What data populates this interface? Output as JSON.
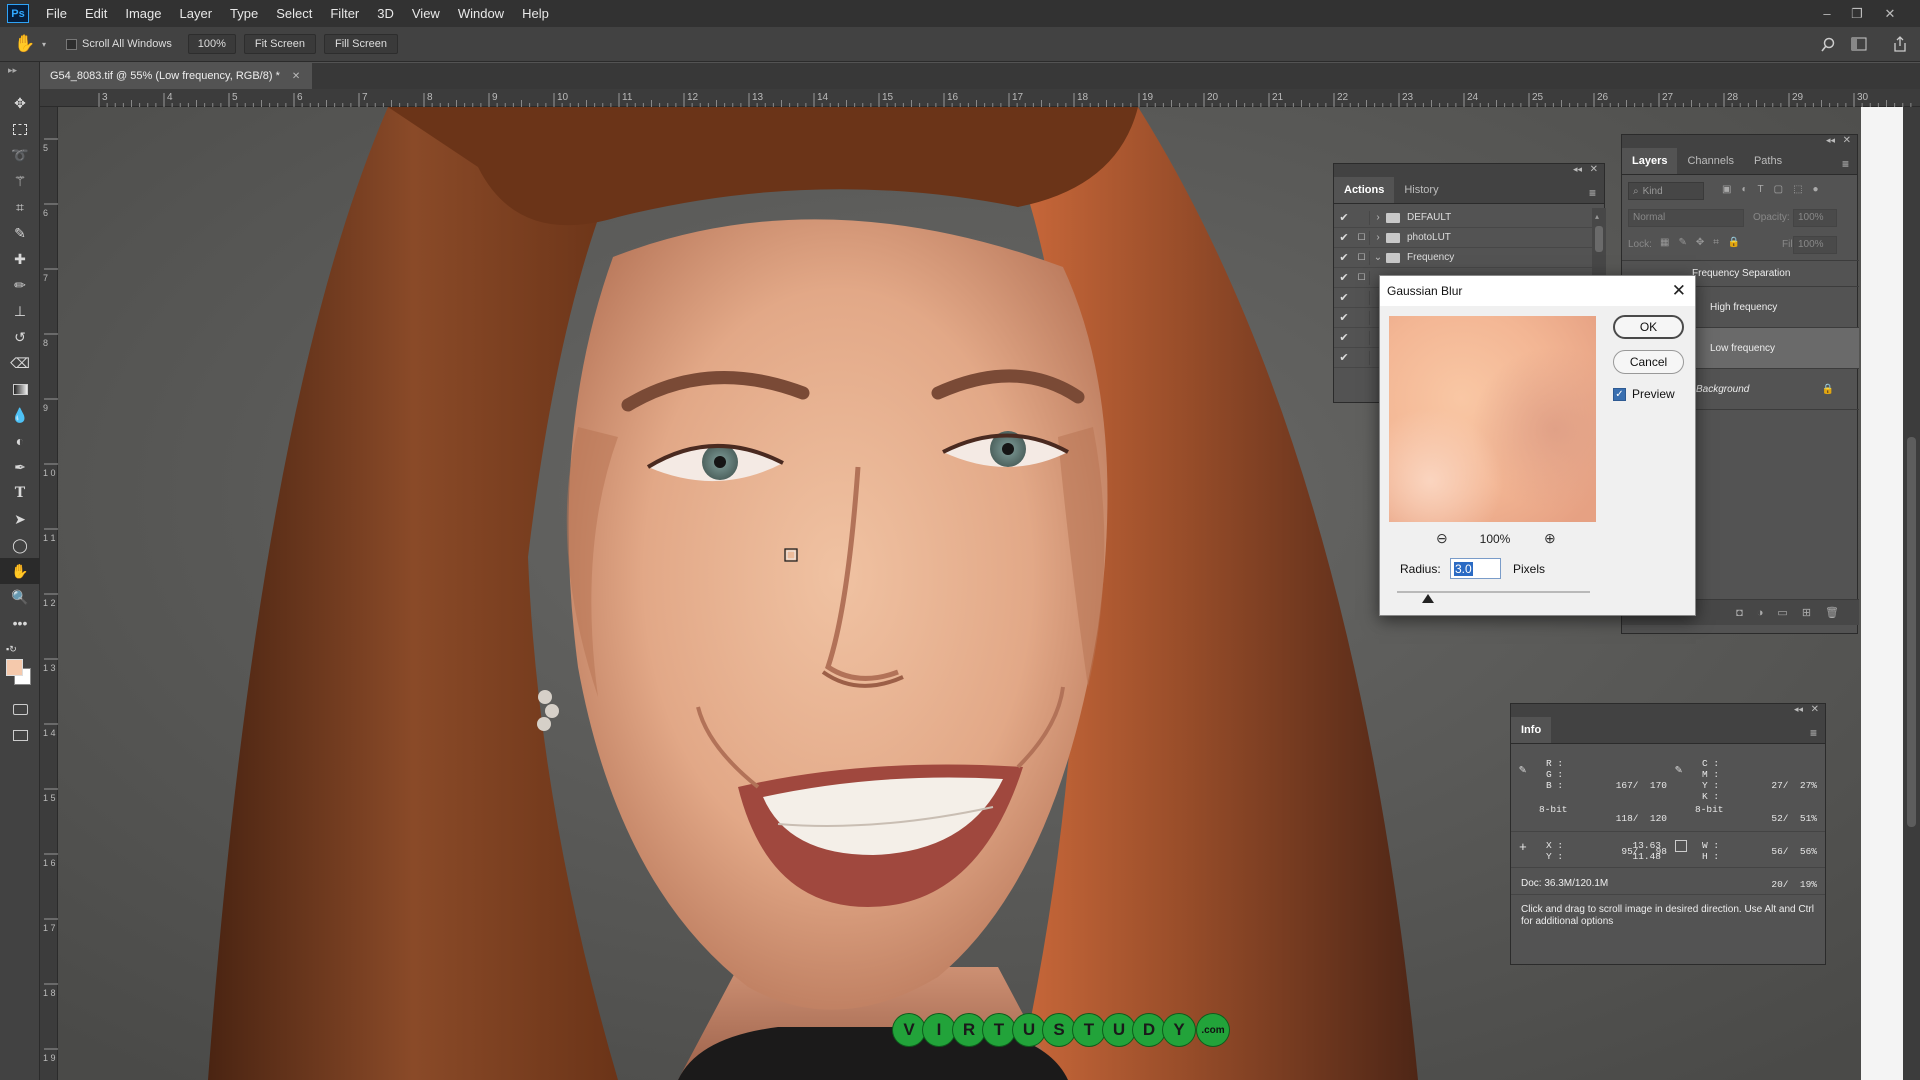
{
  "app": {
    "logo": "Ps"
  },
  "menu": [
    "File",
    "Edit",
    "Image",
    "Layer",
    "Type",
    "Select",
    "Filter",
    "3D",
    "View",
    "Window",
    "Help"
  ],
  "window_controls": {
    "minimize": "–",
    "restore": "❐",
    "close": "✕"
  },
  "options_bar": {
    "scroll_all_windows": "Scroll All Windows",
    "zoom": "100%",
    "fit_screen": "Fit Screen",
    "fill_screen": "Fill Screen"
  },
  "document": {
    "tab_title": "G54_8083.tif @ 55% (Low frequency, RGB/8) *",
    "close": "✕"
  },
  "ruler": {
    "ticks": [
      "3",
      "4",
      "5",
      "6",
      "7",
      "8",
      "9",
      "10",
      "11",
      "12",
      "13",
      "14",
      "15",
      "16",
      "17",
      "18",
      "19",
      "20",
      "21",
      "22",
      "23",
      "24",
      "25",
      "26",
      "27",
      "28",
      "29",
      "30"
    ],
    "v_ticks": [
      "5",
      "6",
      "7",
      "8",
      "9",
      "1 0",
      "1 1",
      "1 2",
      "1 3",
      "1 4",
      "1 5",
      "1 6",
      "1 7",
      "1 8",
      "1 9"
    ]
  },
  "actions_panel": {
    "tabs": [
      "Actions",
      "History"
    ],
    "rows": [
      {
        "check": "✔",
        "name": "DEFAULT",
        "expanded": false
      },
      {
        "check": "✔",
        "name": "photoLUT",
        "expanded": false
      },
      {
        "check": "✔",
        "name": "Frequency",
        "expanded": true
      },
      {
        "check": "✔",
        "name": ""
      },
      {
        "check": "✔",
        "name": ""
      },
      {
        "check": "✔",
        "name": ""
      },
      {
        "check": "✔",
        "name": ""
      },
      {
        "check": "✔",
        "name": ""
      }
    ]
  },
  "layers_panel": {
    "tabs": [
      "Layers",
      "Channels",
      "Paths"
    ],
    "filter_placeholder": "Kind",
    "blend_mode": "Normal",
    "opacity_label": "Opacity:",
    "opacity_value": "100%",
    "lock_label": "Lock:",
    "fill_label": "Fill:",
    "fill_value": "100%",
    "layers": [
      {
        "name": "Frequency Separation",
        "type": "group"
      },
      {
        "name": "High frequency"
      },
      {
        "name": "Low frequency",
        "selected": true
      },
      {
        "name": "Background",
        "locked": true
      }
    ]
  },
  "gaussian_blur": {
    "title": "Gaussian Blur",
    "close": "✕",
    "ok": "OK",
    "cancel": "Cancel",
    "preview_label": "Preview",
    "preview_checked": true,
    "zoom": "100%",
    "radius_label": "Radius:",
    "radius_value": "3.0",
    "radius_unit": "Pixels",
    "slider_fraction": 0.16
  },
  "info_panel": {
    "tab": "Info",
    "rgb": {
      "labels": [
        "R :",
        "G :",
        "B :"
      ],
      "values": [
        "167/  170",
        "118/  120",
        "95/   98"
      ],
      "mode": "8-bit"
    },
    "cmyk": {
      "labels": [
        "C :",
        "M :",
        "Y :",
        "K :"
      ],
      "values": [
        "27/  27%",
        "52/  51%",
        "56/  56%",
        "20/  19%"
      ],
      "mode": "8-bit"
    },
    "xy": {
      "labels": [
        "X :",
        "Y :"
      ],
      "values": [
        "13.63",
        "11.48"
      ]
    },
    "wh": {
      "labels": [
        "W :",
        "H :"
      ]
    },
    "doc": "Doc: 36.3M/120.1M",
    "hint": "Click and drag to scroll image in desired direction.  Use Alt and Ctrl for additional options"
  },
  "watermark": {
    "letters": [
      "V",
      "I",
      "R",
      "T",
      "U",
      "S",
      "T",
      "U",
      "D",
      "Y"
    ],
    "suffix": ".com"
  },
  "colors": {
    "foreground": "#f5c9ac",
    "background": "#ffffff",
    "watermark": "#22a33a"
  }
}
